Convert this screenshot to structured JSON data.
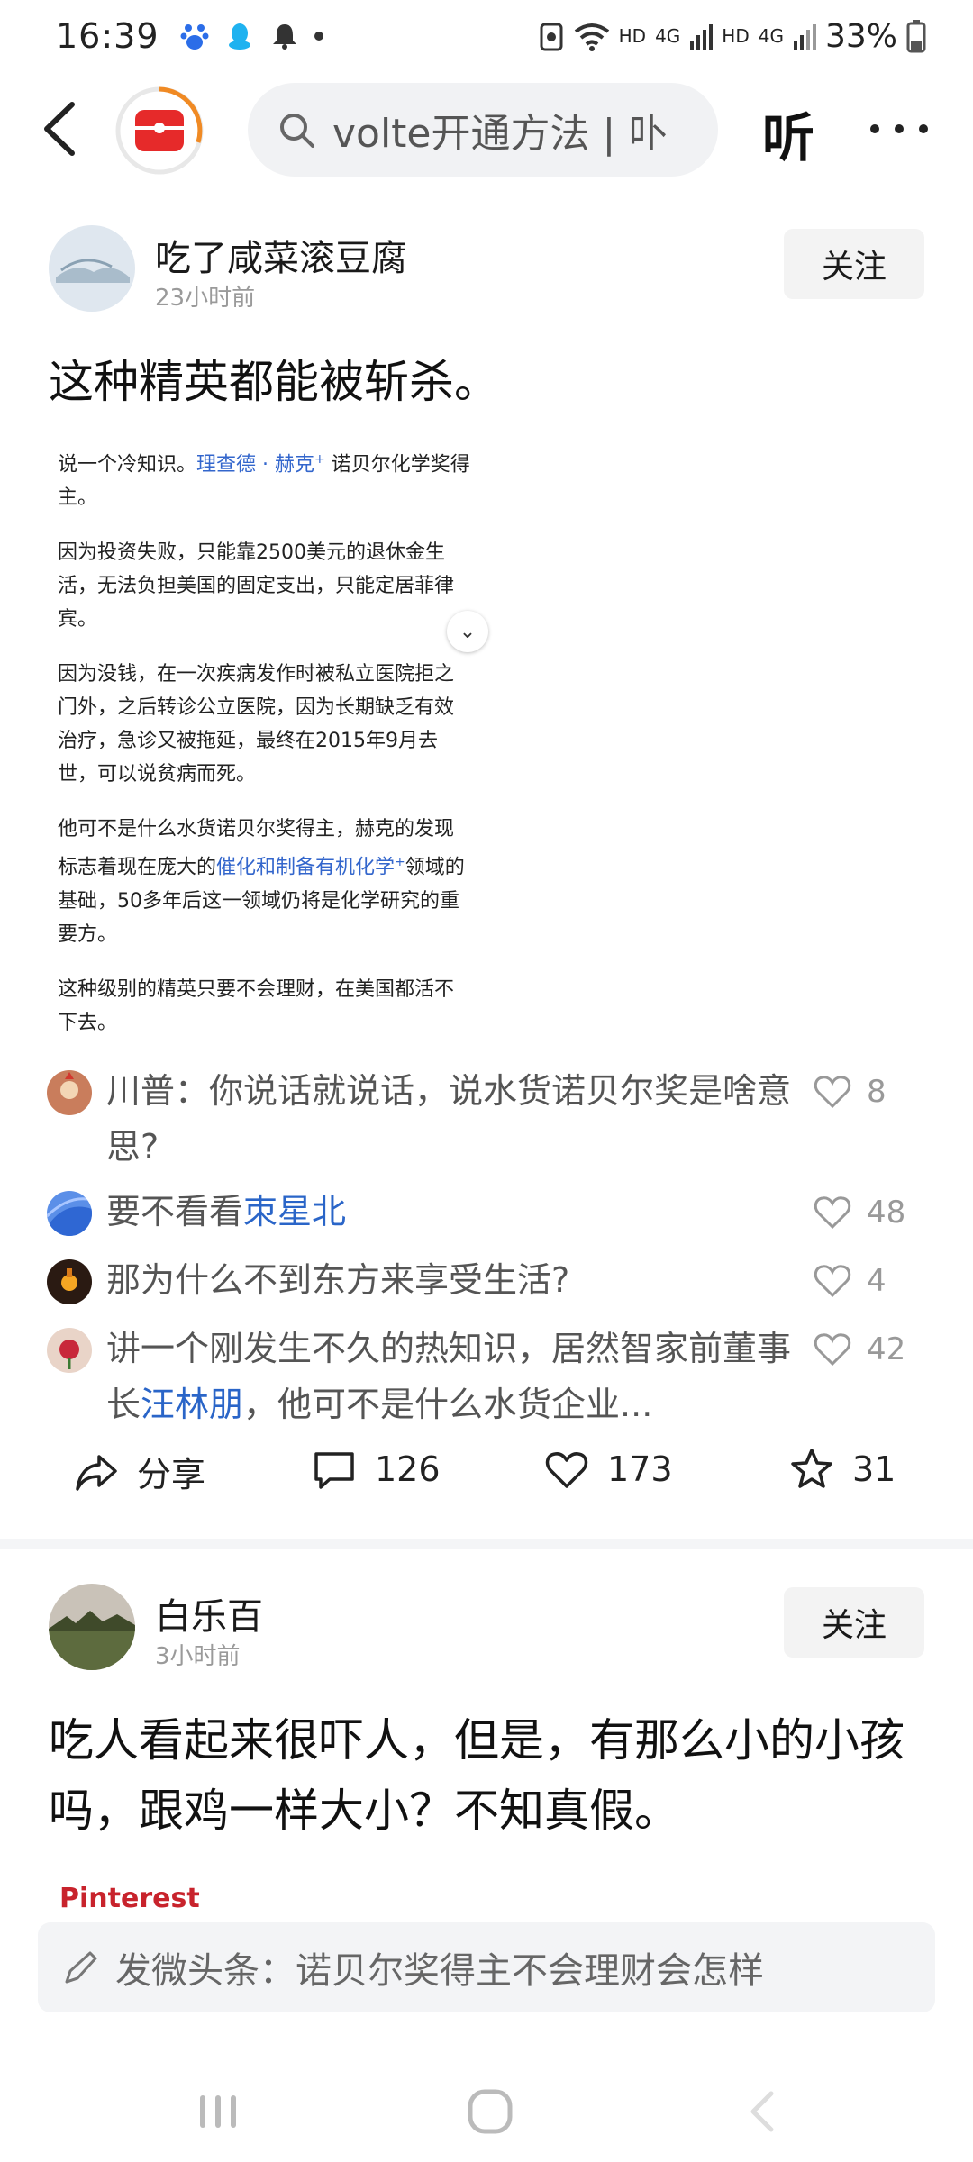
{
  "status": {
    "time": "16:39",
    "battery": "33%",
    "net1": "HD",
    "net2": "4G",
    "net3": "HD",
    "net4": "4G"
  },
  "topnav": {
    "search_text": "volte开通方法 | 卟",
    "listen_label": "听"
  },
  "posts": [
    {
      "author": "吃了咸菜滚豆腐",
      "time": "23小时前",
      "follow_label": "关注",
      "text": "这种精英都能被斩杀。",
      "embed": {
        "p1_a": "说一个冷知识。",
        "p1_link1": "理查德",
        "p1_sep": "·",
        "p1_link2": "赫克",
        "p1_b": "诺贝尔化学奖得主。",
        "p2": "因为投资失败，只能靠2500美元的退休金生活，无法负担美国的固定支出，只能定居菲律宾。",
        "p3": "因为没钱，在一次疾病发作时被私立医院拒之门外，之后转诊公立医院，因为长期缺乏有效治疗，急诊又被拖延，最终在2015年9月去世，可以说贫病而死。",
        "p4_a": "他可不是什么水货诺贝尔奖得主，赫克的发现标志着现在庞大的",
        "p4_link": "催化和制备有机化学",
        "p4_b": "领域的基础，50多年后这一领域仍将是化学研究的重要方。",
        "p5": "这种级别的精英只要不会理财，在美国都活不下去。"
      },
      "comments": [
        {
          "text_a": "川普：你说话就说话，说水货诺贝尔奖是啥意思?",
          "hl": "",
          "text_b": "",
          "likes": "8"
        },
        {
          "text_a": "要不看看",
          "hl": "朿星北",
          "text_b": "",
          "likes": "48"
        },
        {
          "text_a": "那为什么不到东方来享受生活?",
          "hl": "",
          "text_b": "",
          "likes": "4"
        },
        {
          "text_a": "讲一个刚发生不久的热知识，居然智家前董事长",
          "hl": "汪林朋",
          "text_b": "，他可不是什么水货企业...",
          "likes": "42"
        }
      ],
      "actions": {
        "share": "分享",
        "comments": "126",
        "likes": "173",
        "favorites": "31"
      }
    },
    {
      "author": "白乐百",
      "time": "3小时前",
      "follow_label": "关注",
      "text": "吃人看起来很吓人，但是，有那么小的小孩吗，跟鸡一样大小？不知真假。",
      "image_source": "Pinterest"
    }
  ],
  "compose": {
    "placeholder": "发微头条：诺贝尔奖得主不会理财会怎样"
  }
}
